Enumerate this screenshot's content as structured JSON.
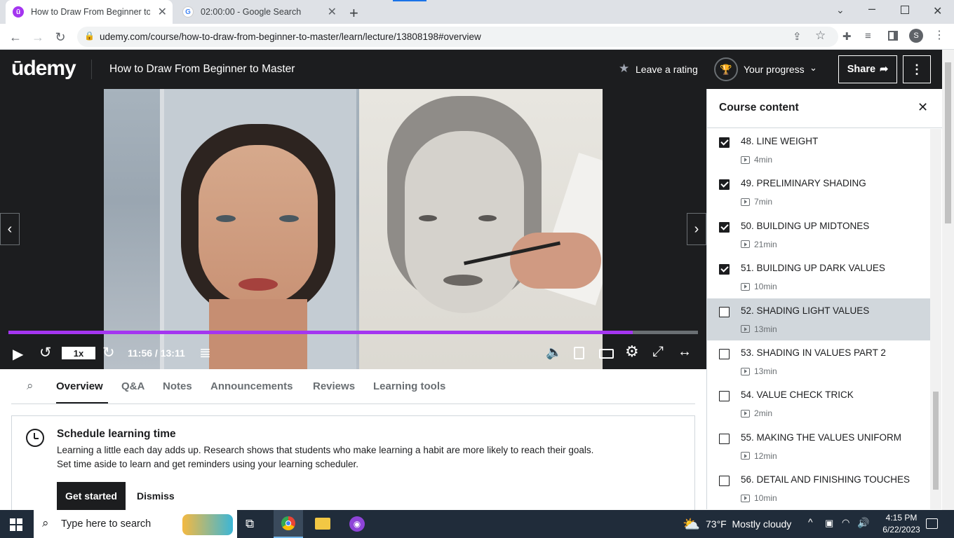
{
  "browser": {
    "tabs": [
      {
        "title": "How to Draw From Beginner to M",
        "active": true
      },
      {
        "title": "02:00:00 - Google Search",
        "active": false
      }
    ],
    "url": "udemy.com/course/how-to-draw-from-beginner-to-master/learn/lecture/13808198#overview",
    "profile_initial": "S"
  },
  "header": {
    "logo": "ūdemy",
    "course_title": "How to Draw From Beginner to Master",
    "rating_label": "Leave a rating",
    "progress_label": "Your progress",
    "share_label": "Share"
  },
  "player": {
    "speed": "1x",
    "time": "11:56 / 13:11",
    "progress_fraction": 0.9057,
    "progress_color": "#a435f0"
  },
  "sidebar": {
    "title": "Course content",
    "items": [
      {
        "title": "48. LINE WEIGHT",
        "duration": "4min",
        "checked": true,
        "current": false
      },
      {
        "title": "49. PRELIMINARY SHADING",
        "duration": "7min",
        "checked": true,
        "current": false
      },
      {
        "title": "50. BUILDING UP MIDTONES",
        "duration": "21min",
        "checked": true,
        "current": false
      },
      {
        "title": "51. BUILDING UP DARK VALUES",
        "duration": "10min",
        "checked": true,
        "current": false
      },
      {
        "title": "52. SHADING LIGHT VALUES",
        "duration": "13min",
        "checked": false,
        "current": true
      },
      {
        "title": "53. SHADING IN VALUES PART 2",
        "duration": "13min",
        "checked": false,
        "current": false
      },
      {
        "title": "54. VALUE CHECK TRICK",
        "duration": "2min",
        "checked": false,
        "current": false
      },
      {
        "title": "55. MAKING THE VALUES UNIFORM",
        "duration": "12min",
        "checked": false,
        "current": false
      },
      {
        "title": "56. DETAIL AND FINISHING TOUCHES",
        "duration": "10min",
        "checked": false,
        "current": false
      }
    ]
  },
  "course_tabs": [
    "Overview",
    "Q&A",
    "Notes",
    "Announcements",
    "Reviews",
    "Learning tools"
  ],
  "schedule": {
    "title": "Schedule learning time",
    "line1": "Learning a little each day adds up. Research shows that students who make learning a habit are more likely to reach their goals.",
    "line2": "Set time aside to learn and get reminders using your learning scheduler.",
    "primary": "Get started",
    "secondary": "Dismiss"
  },
  "taskbar": {
    "search_placeholder": "Type here to search",
    "weather": "73°F  Mostly cloudy",
    "time": "4:15 PM",
    "date": "6/22/2023"
  }
}
